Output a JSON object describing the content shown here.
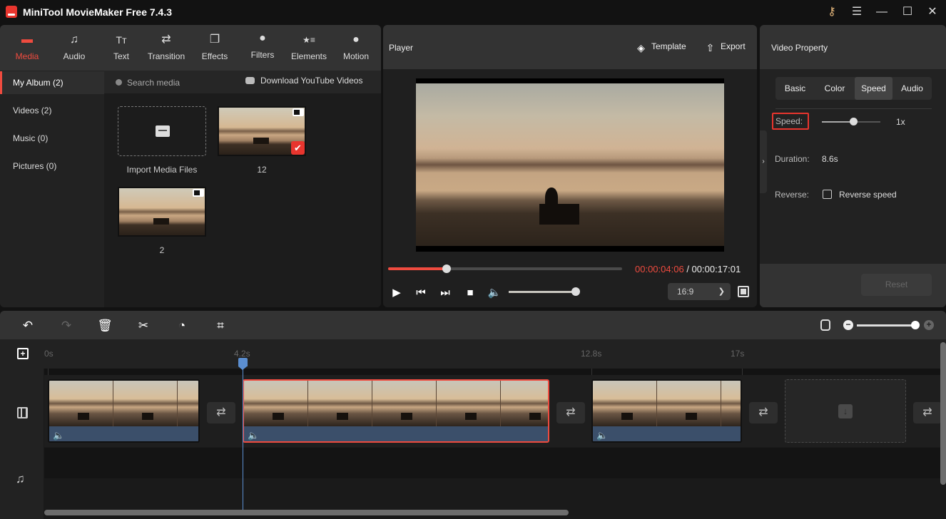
{
  "window": {
    "title": "MiniTool MovieMaker Free 7.4.3",
    "controls": [
      "key-icon",
      "menu-icon",
      "minimize-icon",
      "maximize-icon",
      "close-icon"
    ]
  },
  "top_tabs": [
    {
      "label": "Media",
      "icon": "folder-icon",
      "active": true
    },
    {
      "label": "Audio",
      "icon": "music-note-icon",
      "active": false
    },
    {
      "label": "Text",
      "icon": "text-icon",
      "active": false
    },
    {
      "label": "Transition",
      "icon": "transition-arrows-icon",
      "active": false
    },
    {
      "label": "Effects",
      "icon": "effects-icon",
      "active": false
    },
    {
      "label": "Filters",
      "icon": "filters-icon",
      "active": false
    },
    {
      "label": "Elements",
      "icon": "elements-icon",
      "active": false
    },
    {
      "label": "Motion",
      "icon": "motion-icon",
      "active": false
    }
  ],
  "album_nav": [
    {
      "label": "My Album (2)",
      "active": true
    },
    {
      "label": "Videos (2)",
      "active": false
    },
    {
      "label": "Music (0)",
      "active": false
    },
    {
      "label": "Pictures (0)",
      "active": false
    }
  ],
  "media": {
    "search_placeholder": "Search media",
    "youtube_label": "Download YouTube Videos",
    "import_label": "Import Media Files",
    "items": [
      {
        "label": "12",
        "type": "video",
        "selected": true
      },
      {
        "label": "2",
        "type": "video",
        "selected": false
      }
    ]
  },
  "player": {
    "title": "Player",
    "template_label": "Template",
    "export_label": "Export",
    "current_time": "00:00:04:06",
    "total_time": "/ 00:00:17:01",
    "progress_fraction": 0.25,
    "volume_fraction": 1.0,
    "aspect_ratio": "16:9",
    "controls": [
      "play-icon",
      "previous-icon",
      "next-icon",
      "stop-icon",
      "volume-icon",
      "fullscreen-icon"
    ]
  },
  "property": {
    "title": "Video Property",
    "tabs": [
      {
        "label": "Basic",
        "active": false
      },
      {
        "label": "Color",
        "active": false
      },
      {
        "label": "Speed",
        "active": true
      },
      {
        "label": "Audio",
        "active": false
      }
    ],
    "speed_label": "Speed:",
    "speed_value": "1x",
    "speed_slider_fraction": 0.5,
    "duration_label": "Duration:",
    "duration_value": "8.6s",
    "reverse_label": "Reverse:",
    "reverse_checkbox_label": "Reverse speed",
    "reverse_checked": false,
    "reset_label": "Reset"
  },
  "timeline": {
    "toolbar": [
      "undo-icon",
      "redo-icon",
      "delete-icon",
      "split-icon",
      "speed-icon",
      "crop-icon"
    ],
    "zoom_fraction": 1.0,
    "ticks": [
      "0s",
      "4.2s",
      "12.8s",
      "17s"
    ],
    "playhead_time": "4.2s",
    "clips": [
      {
        "name": "clip-1",
        "selected": false
      },
      {
        "name": "clip-2",
        "selected": true
      },
      {
        "name": "clip-3",
        "selected": false
      }
    ]
  },
  "colors": {
    "accent": "#ef4b3f",
    "playhead": "#5b8ed0",
    "background": "#121212",
    "panel": "#222222"
  }
}
